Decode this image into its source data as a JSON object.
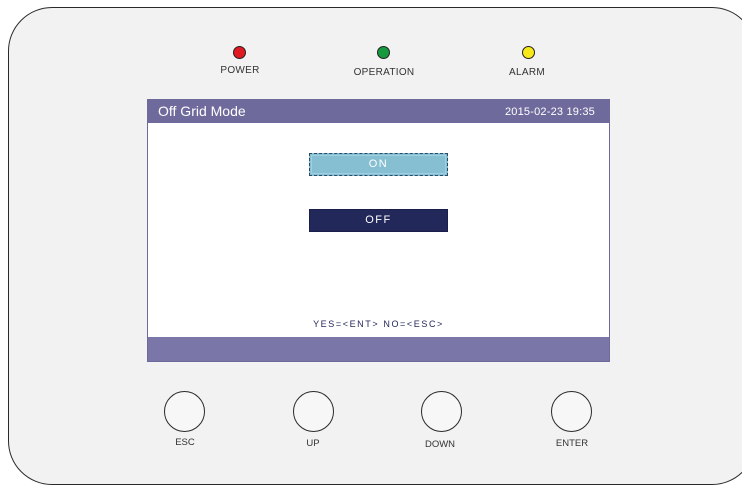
{
  "indicators": [
    {
      "label": "POWER",
      "color": "#e01a22"
    },
    {
      "label": "OPERATION",
      "color": "#169a3d"
    },
    {
      "label": "ALARM",
      "color": "#f7e81a"
    }
  ],
  "screen": {
    "title": "Off Grid Mode",
    "datetime": "2015-02-23  19:35",
    "options": [
      {
        "label": "ON",
        "selected": true
      },
      {
        "label": "OFF",
        "selected": false
      }
    ],
    "hint": "YES=<ENT>  NO=<ESC>"
  },
  "buttons": [
    {
      "label": "ESC"
    },
    {
      "label": "UP"
    },
    {
      "label": "DOWN"
    },
    {
      "label": "ENTER"
    }
  ],
  "colors": {
    "header": "#6e6a9c",
    "selected_option": "#86bfd2",
    "unselected_option": "#23285a"
  }
}
